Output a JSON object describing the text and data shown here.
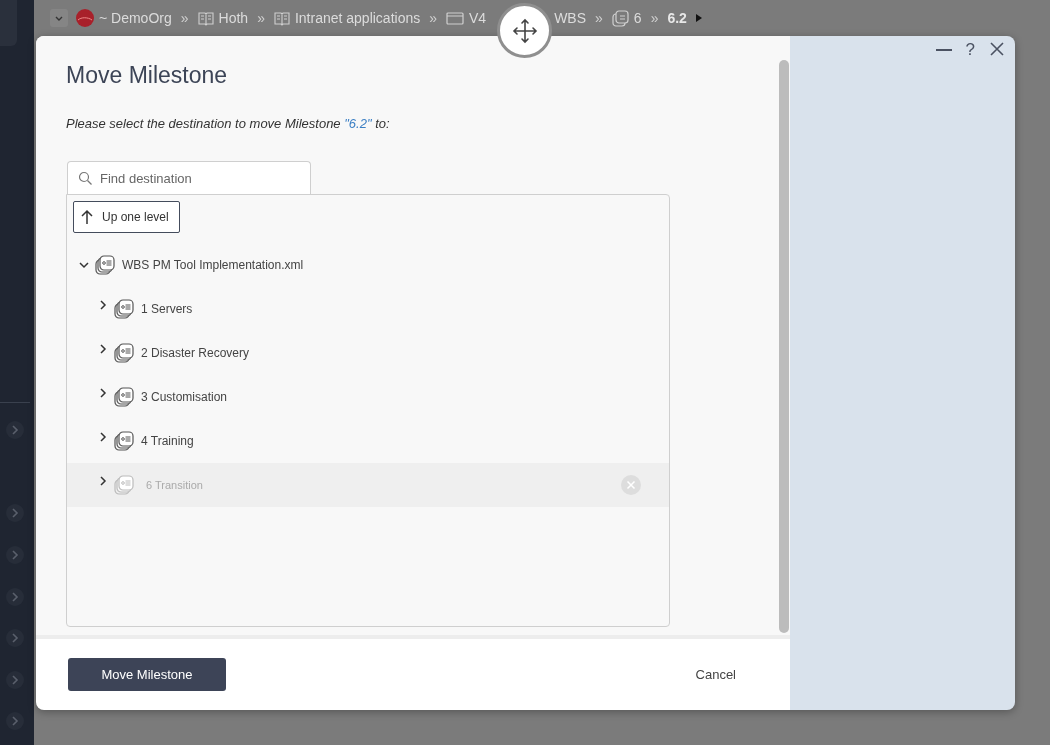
{
  "breadcrumb": {
    "items": [
      {
        "label": "~ DemoOrg",
        "kind": "org"
      },
      {
        "label": "Hoth",
        "kind": "book",
        "separator": "»"
      },
      {
        "label": "Intranet applications",
        "kind": "book",
        "separator": "»"
      },
      {
        "label": "V4",
        "kind": "folder",
        "separator": "»"
      },
      {
        "label": "WBS",
        "kind": "text"
      },
      {
        "label": "6",
        "kind": "wbs",
        "separator": "»"
      },
      {
        "label": "6.2",
        "kind": "current",
        "separator": "»"
      }
    ]
  },
  "dialog": {
    "title": "Move Milestone",
    "instruction": {
      "before": "Please select the destination to move Milestone ",
      "highlight": "\"6.2\"",
      "after": " to:"
    },
    "search": {
      "placeholder": "Find destination"
    },
    "up_button": "Up one level",
    "tree": {
      "label": "WBS PM Tool Implementation.xml",
      "expanded": true,
      "children": [
        {
          "label": "1 Servers",
          "expanded": false,
          "disabled": false,
          "hovered": false
        },
        {
          "label": "2 Disaster Recovery",
          "expanded": false,
          "disabled": false,
          "hovered": false
        },
        {
          "label": "3 Customisation",
          "expanded": false,
          "disabled": false,
          "hovered": false
        },
        {
          "label": "4 Training",
          "expanded": false,
          "disabled": false,
          "hovered": false
        },
        {
          "label": "6 Transition",
          "expanded": false,
          "disabled": true,
          "hovered": true
        }
      ]
    },
    "primary_button": "Move Milestone",
    "cancel": "Cancel",
    "help": "?"
  }
}
